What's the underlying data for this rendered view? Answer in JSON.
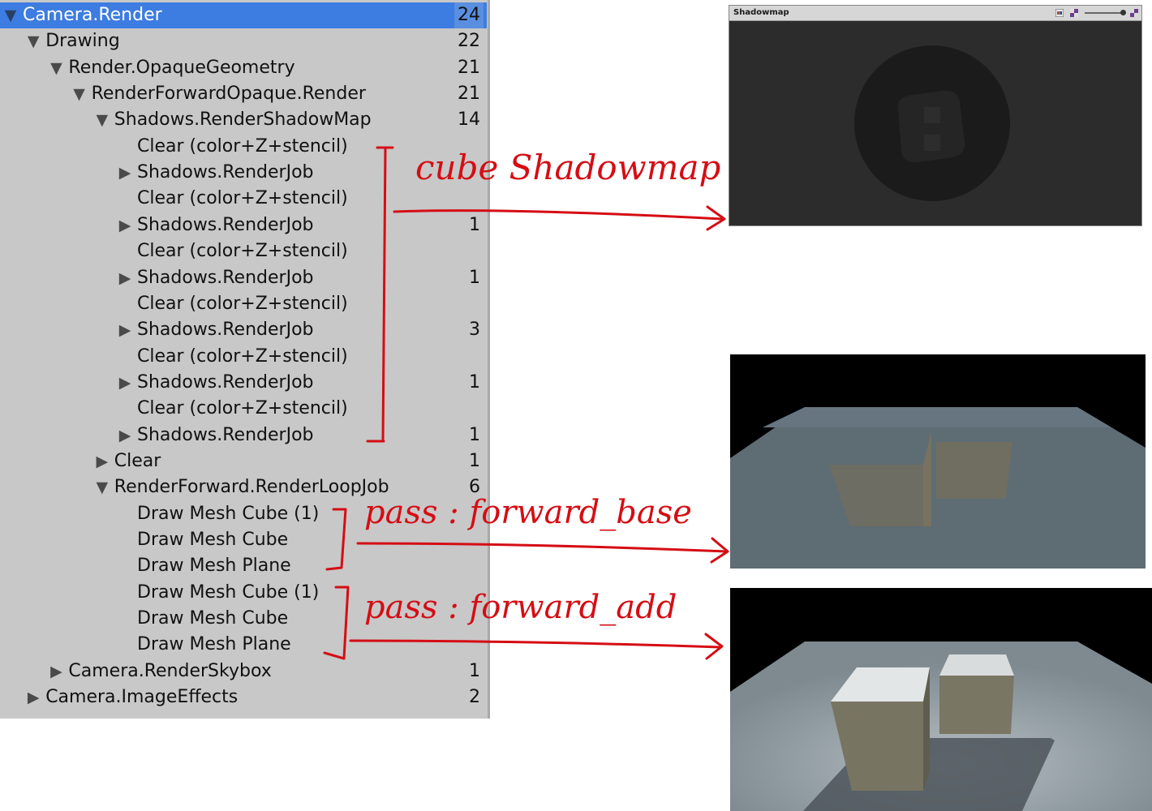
{
  "tree": {
    "rows": [
      {
        "label": "Camera.Render",
        "count": "24",
        "expander": "expanded",
        "selected": true
      },
      {
        "label": "Drawing",
        "count": "22",
        "expander": "expanded"
      },
      {
        "label": "Render.OpaqueGeometry",
        "count": "21",
        "expander": "expanded"
      },
      {
        "label": "RenderForwardOpaque.Render",
        "count": "21",
        "expander": "expanded"
      },
      {
        "label": "Shadows.RenderShadowMap",
        "count": "14",
        "expander": "expanded"
      },
      {
        "label": "Clear (color+Z+stencil)",
        "count": "",
        "expander": "none"
      },
      {
        "label": "Shadows.RenderJob",
        "count": "",
        "expander": "collapsed"
      },
      {
        "label": "Clear (color+Z+stencil)",
        "count": "",
        "expander": "none"
      },
      {
        "label": "Shadows.RenderJob",
        "count": "1",
        "expander": "collapsed"
      },
      {
        "label": "Clear (color+Z+stencil)",
        "count": "",
        "expander": "none"
      },
      {
        "label": "Shadows.RenderJob",
        "count": "1",
        "expander": "collapsed"
      },
      {
        "label": "Clear (color+Z+stencil)",
        "count": "",
        "expander": "none"
      },
      {
        "label": "Shadows.RenderJob",
        "count": "3",
        "expander": "collapsed"
      },
      {
        "label": "Clear (color+Z+stencil)",
        "count": "",
        "expander": "none"
      },
      {
        "label": "Shadows.RenderJob",
        "count": "1",
        "expander": "collapsed"
      },
      {
        "label": "Clear (color+Z+stencil)",
        "count": "",
        "expander": "none"
      },
      {
        "label": "Shadows.RenderJob",
        "count": "1",
        "expander": "collapsed"
      },
      {
        "label": "Clear",
        "count": "1",
        "expander": "collapsed"
      },
      {
        "label": "RenderForward.RenderLoopJob",
        "count": "6",
        "expander": "expanded"
      },
      {
        "label": "Draw Mesh Cube (1)",
        "count": "",
        "expander": "none"
      },
      {
        "label": "Draw Mesh Cube",
        "count": "",
        "expander": "none"
      },
      {
        "label": "Draw Mesh Plane",
        "count": "",
        "expander": "none"
      },
      {
        "label": "Draw Mesh Cube (1)",
        "count": "",
        "expander": "none"
      },
      {
        "label": "Draw Mesh Cube",
        "count": "",
        "expander": "none"
      },
      {
        "label": "Draw Mesh Plane",
        "count": "",
        "expander": "none"
      },
      {
        "label": "Camera.RenderSkybox",
        "count": "1",
        "expander": "collapsed"
      },
      {
        "label": "Camera.ImageEffects",
        "count": "2",
        "expander": "collapsed"
      }
    ],
    "expanded_icon": "triangle-down-icon",
    "collapsed_icon": "triangle-right-icon"
  },
  "shadowmap_window": {
    "title": "Shadowmap",
    "toolbar_icons": [
      "rgb-channels-icon",
      "alpha-checker-icon",
      "mip-slider-icon",
      "checker-icon"
    ]
  },
  "annotations": {
    "cube_shadowmap": "cube Shadowmap",
    "forward_base": "pass : forward_base",
    "forward_add": "pass : forward_add"
  },
  "colors": {
    "panel_bg": "#c8c8c8",
    "selection": "#3d7ce0",
    "annotation_ink": "#d50d14",
    "shadowmap_bg": "#2c2c2c",
    "scene_sky": "#000000",
    "plane_base": "#5d6b73",
    "plane_add": "#9aa5ab",
    "cube_face": "#807a62"
  }
}
